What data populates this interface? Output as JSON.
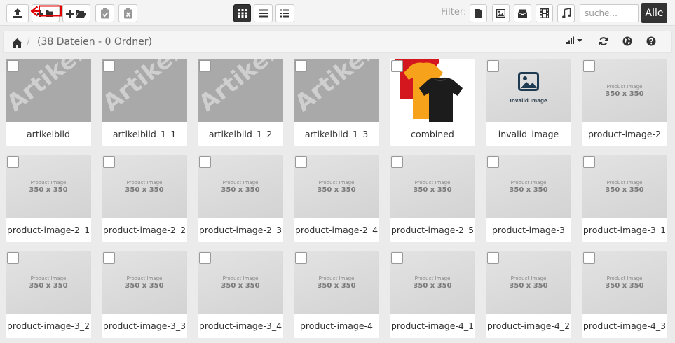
{
  "toolbar": {
    "upload_icon": "upload-icon",
    "new_folder_icon": "new-folder-icon",
    "add_folder_icon": "add-folder-icon",
    "paste_icon": "paste-icon",
    "clear_icon": "clear-clipboard-icon",
    "view_modes": [
      "grid-view-icon",
      "list-view-icon",
      "detail-view-icon"
    ],
    "filter_label": "Filter:",
    "filters": [
      "file-icon",
      "image-icon",
      "archive-icon",
      "video-icon",
      "music-icon"
    ],
    "search_placeholder": "suche...",
    "all_button": "Alle",
    "annotation_color": "#e00000"
  },
  "breadcrumb": {
    "home_icon": "home-icon",
    "separator": "/",
    "info": "(38 Dateien - 0 Ordner)"
  },
  "actions": [
    "sort-icon",
    "refresh-icon",
    "language-icon",
    "help-icon"
  ],
  "tiles": [
    {
      "label": "artikelbild",
      "type": "art",
      "art_text": "Artikelbild"
    },
    {
      "label": "artikelbild_1_1",
      "type": "art",
      "art_text": "Artikelbild"
    },
    {
      "label": "artikelbild_1_2",
      "type": "art",
      "art_text": "Artikelbild"
    },
    {
      "label": "artikelbild_1_3",
      "type": "art",
      "art_text": "Artikelbild"
    },
    {
      "label": "combined",
      "type": "tshirts"
    },
    {
      "label": "invalid_image",
      "type": "invalid",
      "caption": "Invalid Image"
    },
    {
      "label": "product-image-2",
      "type": "ph",
      "small": "Product Image",
      "big": "350 x 350"
    },
    {
      "label": "product-image-2_1",
      "type": "ph",
      "small": "Product Image",
      "big": "350 x 350"
    },
    {
      "label": "product-image-2_2",
      "type": "ph",
      "small": "Product Image",
      "big": "350 x 350"
    },
    {
      "label": "product-image-2_3",
      "type": "ph",
      "small": "Product Image",
      "big": "350 x 350"
    },
    {
      "label": "product-image-2_4",
      "type": "ph",
      "small": "Product Image",
      "big": "350 x 350"
    },
    {
      "label": "product-image-2_5",
      "type": "ph",
      "small": "Product Image",
      "big": "350 x 350"
    },
    {
      "label": "product-image-3",
      "type": "ph",
      "small": "Product Image",
      "big": "350 x 350"
    },
    {
      "label": "product-image-3_1",
      "type": "ph",
      "small": "Product Image",
      "big": "350 x 350"
    },
    {
      "label": "product-image-3_2",
      "type": "ph",
      "small": "Product Image",
      "big": "350 x 350"
    },
    {
      "label": "product-image-3_3",
      "type": "ph",
      "small": "Product Image",
      "big": "350 x 350"
    },
    {
      "label": "product-image-3_4",
      "type": "ph",
      "small": "Product Image",
      "big": "350 x 350"
    },
    {
      "label": "product-image-4",
      "type": "ph",
      "small": "Product Image",
      "big": "350 x 350"
    },
    {
      "label": "product-image-4_1",
      "type": "ph",
      "small": "Product Image",
      "big": "350 x 350"
    },
    {
      "label": "product-image-4_2",
      "type": "ph",
      "small": "Product Image",
      "big": "350 x 350"
    },
    {
      "label": "product-image-4_3",
      "type": "ph",
      "small": "Product Image",
      "big": "350 x 350"
    }
  ]
}
